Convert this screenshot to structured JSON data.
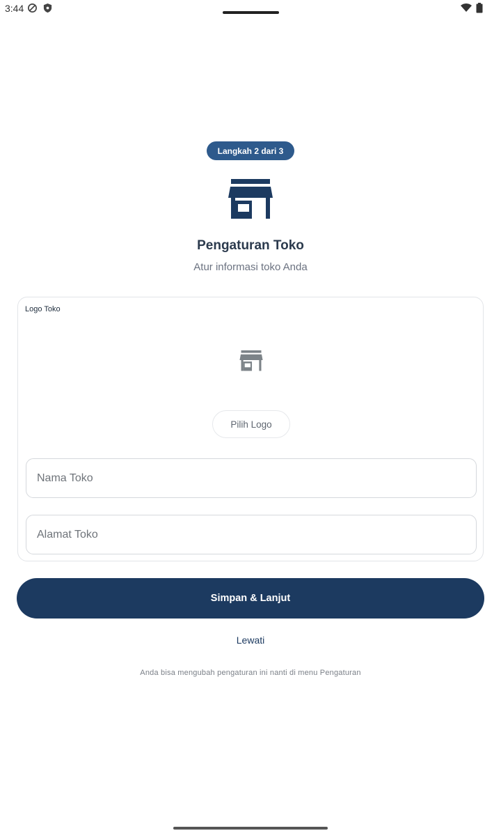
{
  "status_bar": {
    "time": "3:44",
    "icons": [
      "do-not-disturb-icon",
      "shield-icon",
      "wifi-icon",
      "battery-icon"
    ]
  },
  "step_badge": "Langkah 2 dari 3",
  "header": {
    "icon": "store-icon",
    "title": "Pengaturan Toko",
    "subtitle": "Atur informasi toko Anda"
  },
  "logo_section": {
    "label": "Logo Toko",
    "placeholder_icon": "store-icon",
    "pick_button": "Pilih Logo"
  },
  "fields": {
    "store_name_placeholder": "Nama Toko",
    "store_address_placeholder": "Alamat Toko"
  },
  "actions": {
    "primary": "Simpan & Lanjut",
    "skip": "Lewati"
  },
  "footnote": "Anda bisa mengubah pengaturan ini nanti di menu Pengaturan",
  "colors": {
    "primary": "#1c3a60",
    "badge": "#2e5a8c",
    "placeholder_icon": "#7c8388"
  }
}
